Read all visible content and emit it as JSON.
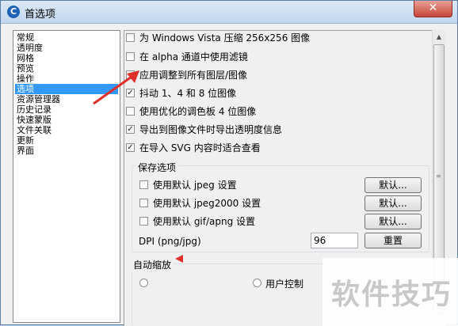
{
  "window": {
    "title": "首选项"
  },
  "nav": {
    "items": [
      "常规",
      "透明度",
      "网格",
      "预览",
      "操作",
      "选项",
      "资源管理器",
      "历史记录",
      "快速蒙版",
      "文件关联",
      "更新",
      "界面"
    ],
    "selected": "选项"
  },
  "options": [
    {
      "label": "为 Windows Vista 压缩 256x256 图像",
      "checked": false
    },
    {
      "label": "在 alpha 通道中使用滤镜",
      "checked": false
    },
    {
      "label": "应用调整到所有图层/图像",
      "checked": false
    },
    {
      "label": "抖动 1、4 和 8 位图像",
      "checked": true
    },
    {
      "label": "使用优化的调色板 4 位图像",
      "checked": false
    },
    {
      "label": "导出到图像文件时导出透明度信息",
      "checked": true
    },
    {
      "label": "在导入 SVG 内容时适合查看",
      "checked": true
    }
  ],
  "save_group": {
    "title": "保存选项",
    "rows": [
      {
        "label": "使用默认 jpeg 设置",
        "checked": false,
        "button": "默认..."
      },
      {
        "label": "使用默认 jpeg2000 设置",
        "checked": false,
        "button": "默认..."
      },
      {
        "label": "使用默认 gif/apng 设置",
        "checked": false,
        "button": "默认..."
      }
    ],
    "dpi_label": "DPI (png/jpg)",
    "dpi_value": "96",
    "reset_button": "重置"
  },
  "zoom_group": {
    "title": "自动缩放",
    "radio_a": "",
    "radio_b": "用户控制",
    "radio_b_visible": "用户控制"
  },
  "watermark": {
    "text": "软件技巧"
  },
  "colors": {
    "accent": "#3399ff",
    "arrow": "#e0302a",
    "title_bar": "#c3d7ee",
    "close": "#c7463a"
  },
  "icons": {
    "app": "app-logo-icon",
    "close": "close-icon",
    "check": "check-icon",
    "scroll_up": "chevron-up-icon",
    "scroll_down": "chevron-down-icon"
  }
}
